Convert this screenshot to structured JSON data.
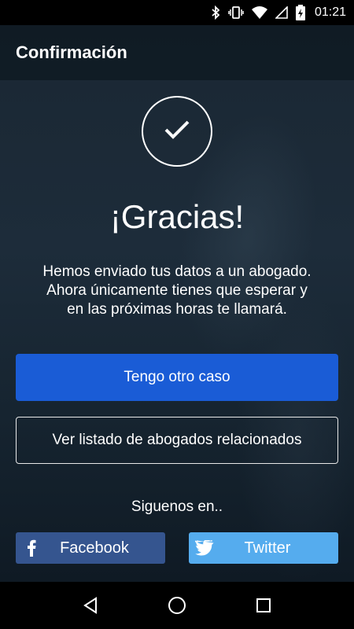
{
  "status_bar": {
    "time": "01:21",
    "icons": [
      "bluetooth-icon",
      "vibrate-icon",
      "wifi-icon",
      "signal-icon",
      "battery-charging-icon"
    ]
  },
  "app_bar": {
    "title": "Confirmación"
  },
  "confirmation": {
    "icon": "checkmark-icon",
    "heading": "¡Gracias!",
    "message": "Hemos enviado tus datos a un abogado. Ahora únicamente tienes que esperar y en las próximas horas te llamará."
  },
  "actions": {
    "primary_label": "Tengo otro caso",
    "secondary_label": "Ver listado de abogados relacionados"
  },
  "social": {
    "label": "Siguenos en..",
    "facebook_label": "Facebook",
    "twitter_label": "Twitter",
    "facebook_color": "#35558f",
    "twitter_color": "#55acee"
  },
  "nav_bar": {
    "icons": [
      "back-icon",
      "home-icon",
      "recents-icon"
    ]
  },
  "colors": {
    "primary_button": "#1a5cd6",
    "background": "#1d2c3a"
  }
}
